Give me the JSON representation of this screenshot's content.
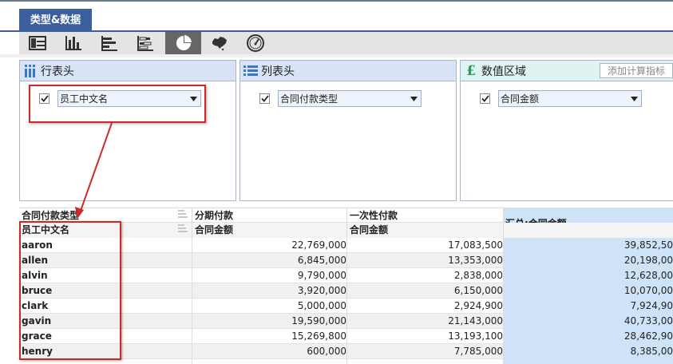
{
  "tab": {
    "label": "类型&数据"
  },
  "toolbar": {
    "buttons": [
      "table-icon",
      "column-chart-icon",
      "bar-chart-icon",
      "stacked-bar-icon",
      "pie-chart-icon",
      "map-icon",
      "gauge-icon"
    ],
    "active": "pie-chart-icon"
  },
  "panels": {
    "rows": {
      "title": "行表头",
      "field": "员工中文名"
    },
    "cols": {
      "title": "列表头",
      "field": "合同付款类型"
    },
    "values": {
      "title": "数值区域",
      "field": "合同金额",
      "add_button": "添加计算指标"
    }
  },
  "table": {
    "col_dim_header": "合同付款类型",
    "row_dim_header": "员工中文名",
    "group1": "分期付款",
    "group2": "一次性付款",
    "measure1": "合同金额",
    "measure2": "合同金额",
    "total_header": "汇总:合同金额",
    "rows": [
      {
        "name": "aaron",
        "v1": "22,769,000",
        "v2": "17,083,500",
        "total": "39,852,50"
      },
      {
        "name": "allen",
        "v1": "6,845,000",
        "v2": "13,353,000",
        "total": "20,198,00"
      },
      {
        "name": "alvin",
        "v1": "9,790,000",
        "v2": "2,838,000",
        "total": "12,628,00"
      },
      {
        "name": "bruce",
        "v1": "3,920,000",
        "v2": "6,150,000",
        "total": "10,070,00"
      },
      {
        "name": "clark",
        "v1": "5,000,000",
        "v2": "2,924,900",
        "total": "7,924,90"
      },
      {
        "name": "gavin",
        "v1": "19,590,000",
        "v2": "21,143,000",
        "total": "40,733,00"
      },
      {
        "name": "grace",
        "v1": "15,269,800",
        "v2": "13,193,100",
        "total": "28,462,90"
      },
      {
        "name": "henry",
        "v1": "600,000",
        "v2": "7,785,000",
        "total": "8,385,00"
      }
    ]
  },
  "colors": {
    "tab_blue": "#3b5f9c",
    "annotation_red": "#cc2a2a",
    "total_col": "#cfe3f8"
  }
}
